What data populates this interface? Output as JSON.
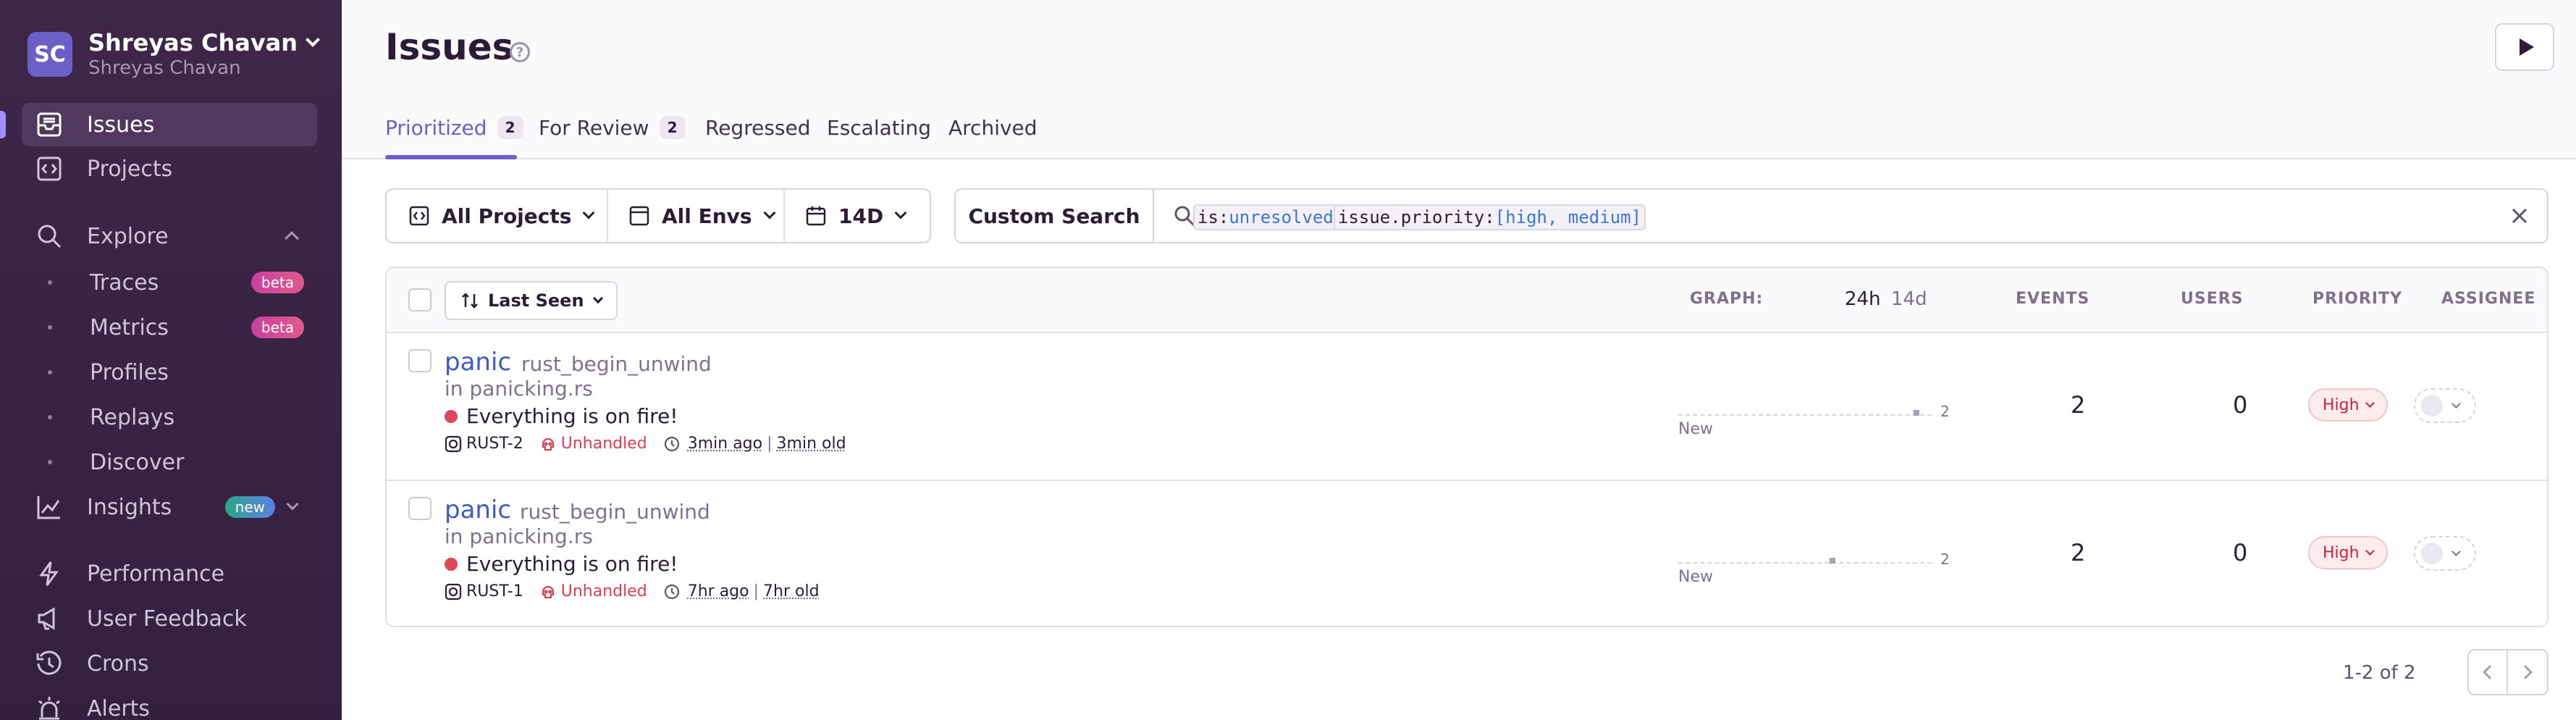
{
  "sidebar": {
    "org_initials": "SC",
    "org_name": "Shreyas Chavan",
    "org_sub": "Shreyas Chavan",
    "items": {
      "issues": "Issues",
      "projects": "Projects",
      "explore": "Explore",
      "traces": "Traces",
      "metrics": "Metrics",
      "profiles": "Profiles",
      "replays": "Replays",
      "discover": "Discover",
      "insights": "Insights",
      "performance": "Performance",
      "user_feedback": "User Feedback",
      "crons": "Crons",
      "alerts": "Alerts"
    },
    "badges": {
      "traces": "beta",
      "metrics": "beta",
      "insights": "new"
    }
  },
  "header": {
    "title": "Issues",
    "help": "?",
    "tabs": [
      {
        "label": "Prioritized",
        "count": "2"
      },
      {
        "label": "For Review",
        "count": "2"
      },
      {
        "label": "Regressed"
      },
      {
        "label": "Escalating"
      },
      {
        "label": "Archived"
      }
    ]
  },
  "filters": {
    "projects": "All Projects",
    "envs": "All Envs",
    "period": "14D",
    "custom_search": "Custom Search",
    "query_tokens": [
      {
        "key": "is:",
        "value": "unresolved"
      },
      {
        "key": "issue.priority:",
        "value": "[high, medium]"
      }
    ]
  },
  "table": {
    "sort_label": "Last Seen",
    "columns": {
      "graph": "GRAPH:",
      "graph_24h": "24h",
      "graph_14d": "14d",
      "events": "EVENTS",
      "users": "USERS",
      "priority": "PRIORITY",
      "assignee": "ASSIGNEE"
    },
    "rows": [
      {
        "type": "panic",
        "location": "rust_begin_unwind",
        "file": "in panicking.rs",
        "message": "Everything is on fire!",
        "short_id": "RUST-2",
        "mechanism": "Unhandled",
        "last_seen": "3min ago",
        "age": "3min old",
        "spark_max": "2",
        "spark_label": "New",
        "spark_position": 0.95,
        "events": "2",
        "users": "0",
        "priority": "High"
      },
      {
        "type": "panic",
        "location": "rust_begin_unwind",
        "file": "in panicking.rs",
        "message": "Everything is on fire!",
        "short_id": "RUST-1",
        "mechanism": "Unhandled",
        "last_seen": "7hr ago",
        "age": "7hr old",
        "spark_max": "2",
        "spark_label": "New",
        "spark_position": 0.61,
        "events": "2",
        "users": "0",
        "priority": "High"
      }
    ]
  },
  "pagination": {
    "text": "1-2 of 2"
  },
  "colors": {
    "accent": "#6c5fc7",
    "sidebar_bg": "#3e2648",
    "link": "#3d5bc4",
    "error": "#e1475a",
    "priority_high": "#c5263c"
  }
}
